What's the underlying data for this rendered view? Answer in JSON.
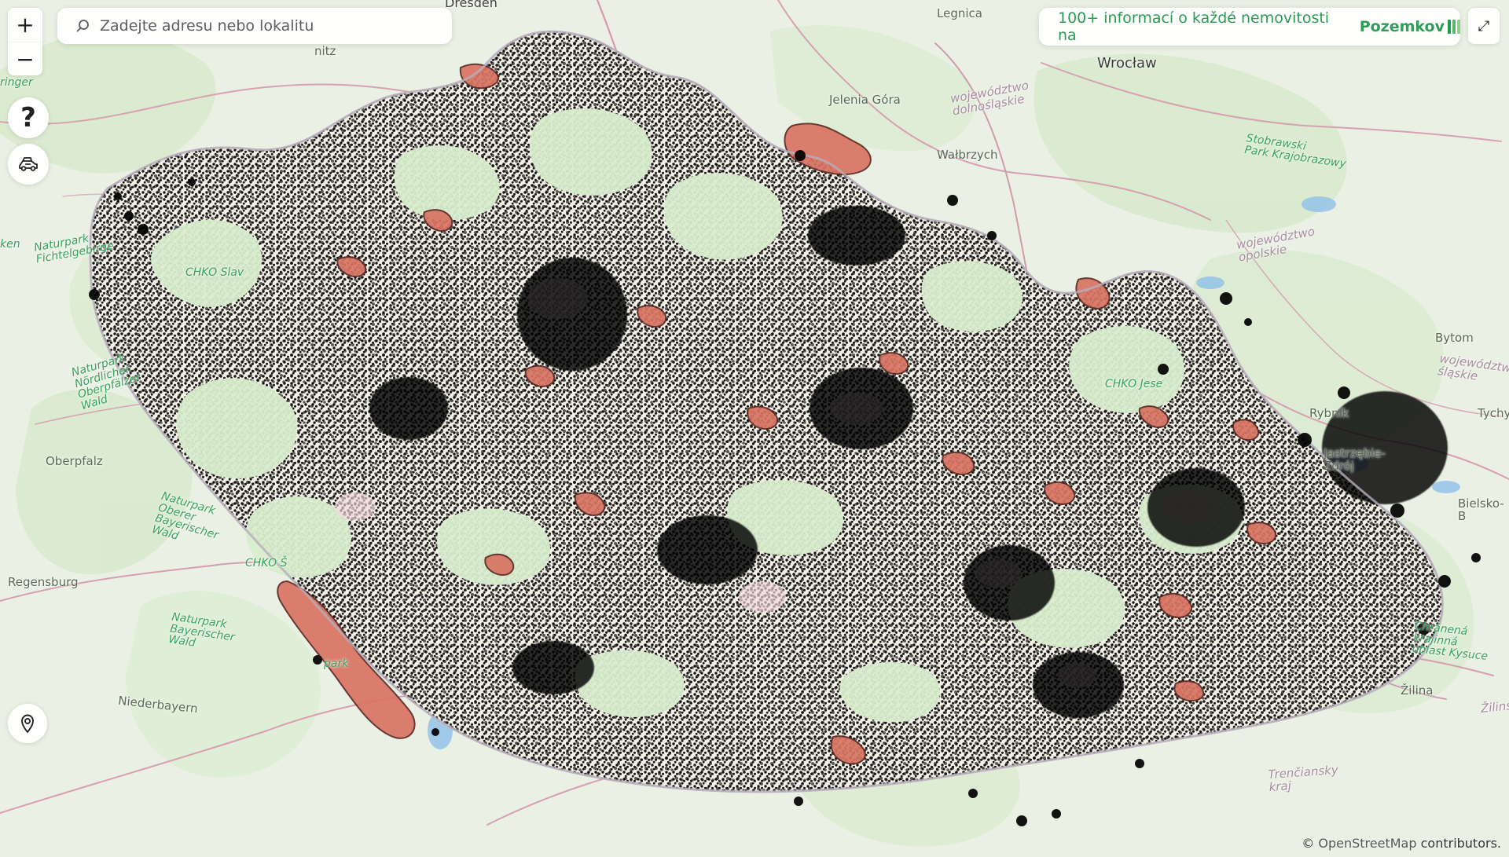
{
  "map": {
    "search": {
      "placeholder": "Zadejte adresu nebo lokalitu"
    },
    "zoom": {
      "in": "+",
      "out": "−"
    },
    "help": "?",
    "fullscreen": "⤢",
    "promo": {
      "text": "100+ informací o každé nemovitosti na",
      "brand": "Pozemkov"
    },
    "attribution": {
      "symbol": "©",
      "link": "OpenStreetMap",
      "suffix": "contributors."
    },
    "labels": {
      "dresden": "Dresden",
      "legnica": "Legnica",
      "wroclaw": "Wrocław",
      "jelenia_gora": "Jelenia Góra",
      "wojewodztwo_dolnoslaskie": "województwo\ndolnośląskie",
      "walbrzych": "Wałbrzych",
      "stobrawski": "Stobrawski\nPark Krajobrazowy",
      "wojewodztwo_opolskie": "województwo\nopolskie",
      "bytom": "Bytom",
      "wojewodztwo_slaskie": "województwo\nśląskie",
      "rybnik": "Rybník",
      "tychy": "Tychy",
      "jastrzebie_zdroj": "Jastrzębie-\nZdrój",
      "bielsko": "Bielsko-B",
      "chranena": "Chránená\nkrajinná\noblast Kysuce",
      "zilina": "Žilina",
      "zilins": "Žilins",
      "trenciansky": "Trenčiansky\nkraj",
      "naturpark_fichtelgebirge": "Naturpark\nFichtelgebirge",
      "naturpark_nordlicher": "Naturpark\nNördlicher\nOberpfälzer\nWald",
      "oberpfalz": "Oberpfalz",
      "naturpark_oberer": "Naturpark\nOberer\nBayerischer\nWald",
      "naturpark_bayerischer": "Naturpark\nBayerischer\nWald",
      "regensburg": "Regensburg",
      "niederbayern": "Niederbayern",
      "chko_slav": "CHKO Slav",
      "chko_jese": "CHKO Jese",
      "chko_s": "CHKO Š",
      "park": "park",
      "chk": "CHK",
      "mitz": "nitz",
      "ringer": "ringer",
      "park_left": "park",
      "ken": "ken"
    }
  }
}
